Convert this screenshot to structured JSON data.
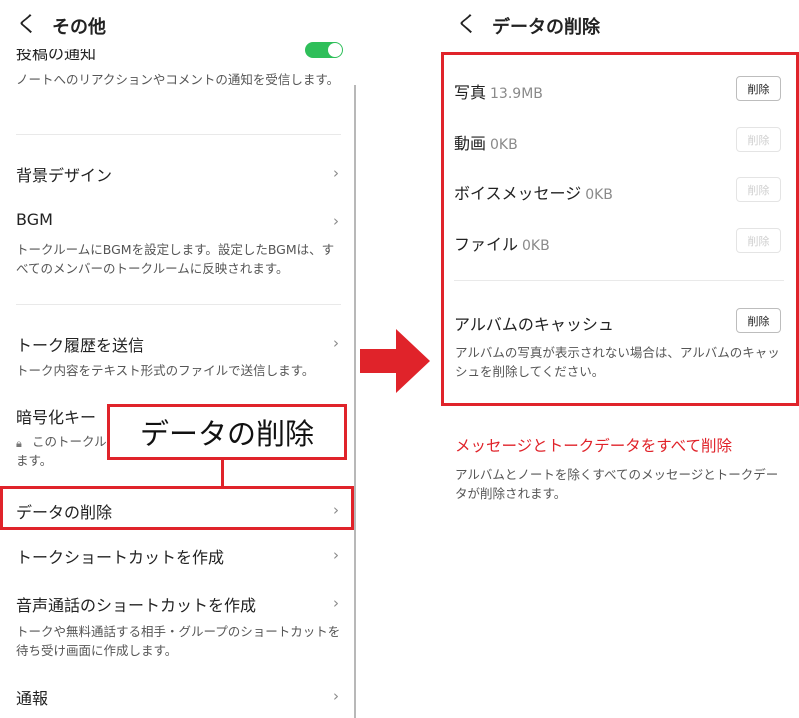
{
  "left": {
    "header": {
      "back_glyph": "く",
      "title": "その他"
    },
    "partial_row_title": "投稿の通知",
    "partial_row_desc": "ノートへのリアクションやコメントの通知を受信します。",
    "rows": [
      {
        "title": "背景デザイン",
        "desc": ""
      },
      {
        "title": "BGM",
        "desc": "トークルームにBGMを設定します。設定したBGMは、すべてのメンバーのトークルームに反映されます。"
      },
      {
        "title": "トーク履歴を送信",
        "desc": "トーク内容をテキスト形式のファイルで送信します。"
      },
      {
        "title": "暗号化キー",
        "desc_visible": "このトークル",
        "desc_line2": "ます。"
      },
      {
        "title": "データの削除",
        "desc": ""
      },
      {
        "title": "トークショートカットを作成",
        "desc": ""
      },
      {
        "title": "音声通話のショートカットを作成",
        "desc": "トークや無料通話する相手・グループのショートカットを待ち受け画面に作成します。"
      },
      {
        "title": "通報",
        "desc": ""
      }
    ],
    "chevron": "›",
    "callout_text": "データの削除"
  },
  "right": {
    "header": {
      "back_glyph": "く",
      "title": "データの削除"
    },
    "items": [
      {
        "label": "写真",
        "size": "13.9MB",
        "button": "削除",
        "enabled": true
      },
      {
        "label": "動画",
        "size": "0KB",
        "button": "削除",
        "enabled": false
      },
      {
        "label": "ボイスメッセージ",
        "size": "0KB",
        "button": "削除",
        "enabled": false
      },
      {
        "label": "ファイル",
        "size": "0KB",
        "button": "削除",
        "enabled": false
      }
    ],
    "album": {
      "label": "アルバムのキャッシュ",
      "button": "削除",
      "desc": "アルバムの写真が表示されない場合は、アルバムのキャッシュを削除してください。"
    },
    "delete_all": {
      "label": "メッセージとトークデータをすべて削除",
      "desc": "アルバムとノートを除くすべてのメッセージとトークデータが削除されます。"
    }
  },
  "colors": {
    "highlight": "#e0232a",
    "toggle_on": "#2fbf5a"
  }
}
